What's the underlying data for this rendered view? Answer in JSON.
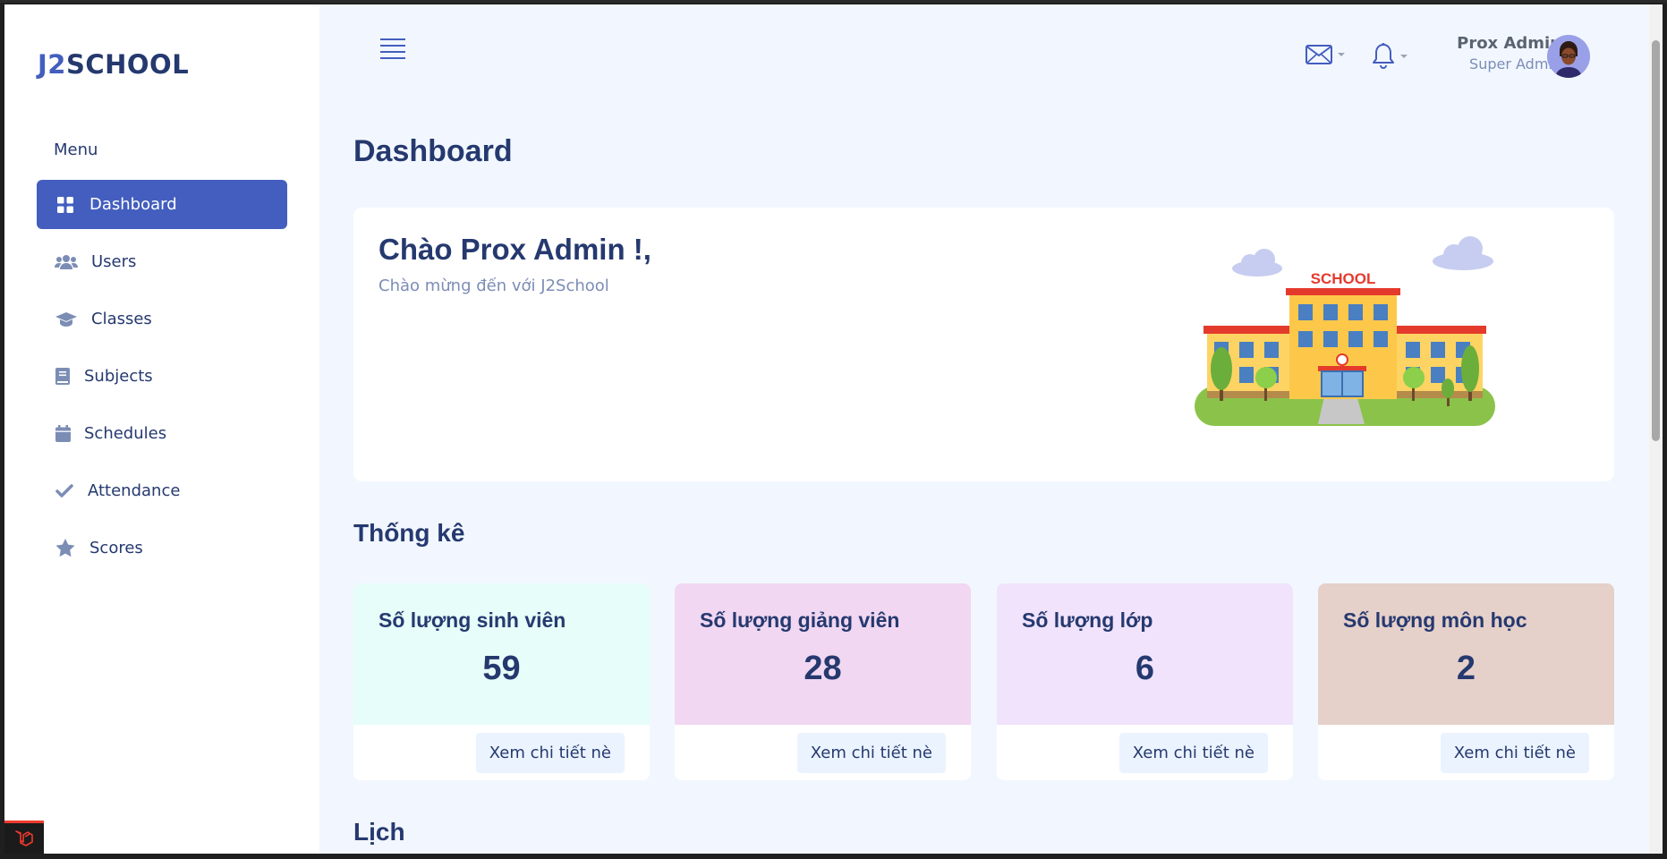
{
  "app": {
    "logo_prefix": "J2",
    "logo_suffix": "SCHOOL"
  },
  "sidebar": {
    "menu_title": "Menu",
    "items": [
      {
        "label": "Dashboard",
        "icon": "grid-icon",
        "active": true
      },
      {
        "label": "Users",
        "icon": "users-icon"
      },
      {
        "label": "Classes",
        "icon": "graduation-cap-icon"
      },
      {
        "label": "Subjects",
        "icon": "book-icon"
      },
      {
        "label": "Schedules",
        "icon": "calendar-icon"
      },
      {
        "label": "Attendance",
        "icon": "check-icon"
      },
      {
        "label": "Scores",
        "icon": "star-icon"
      }
    ]
  },
  "header": {
    "user_name": "Prox Admin",
    "user_role": "Super Admin"
  },
  "page": {
    "title": "Dashboard"
  },
  "welcome": {
    "greeting": "Chào Prox Admin !,",
    "subtitle": "Chào mừng đến với J2School",
    "image_sign": "SCHOOL"
  },
  "stats": {
    "section_title": "Thống kê",
    "cards": [
      {
        "label": "Số lượng sinh viên",
        "value": "59",
        "button": "Xem chi tiết nè",
        "color": "#e6fdf9"
      },
      {
        "label": "Số lượng giảng viên",
        "value": "28",
        "button": "Xem chi tiết nè",
        "color": "#f1d7f2"
      },
      {
        "label": "Số lượng lớp",
        "value": "6",
        "button": "Xem chi tiết nè",
        "color": "#f1e3fc"
      },
      {
        "label": "Số lượng môn học",
        "value": "2",
        "button": "Xem chi tiết nè",
        "color": "#e6d0ca"
      }
    ]
  },
  "calendar": {
    "section_title": "Lịch"
  },
  "colors": {
    "primary": "#435ebe",
    "text": "#25396f",
    "muted": "#7c8db5",
    "background": "#f2f7ff"
  }
}
